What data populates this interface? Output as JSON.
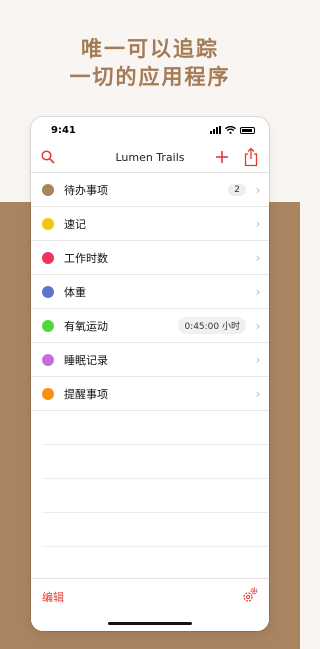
{
  "headline": {
    "line1": "唯一可以追踪",
    "line2": "一切的应用程序"
  },
  "status_bar": {
    "time": "9:41"
  },
  "nav": {
    "title": "Lumen Trails"
  },
  "items": [
    {
      "label": "待办事项",
      "color": "#a98461",
      "badge": "2"
    },
    {
      "label": "速记",
      "color": "#f2c70e"
    },
    {
      "label": "工作时数",
      "color": "#f0325f"
    },
    {
      "label": "体重",
      "color": "#5b78c8"
    },
    {
      "label": "有氧运动",
      "color": "#4ed93a",
      "value": "0:45:00 小时"
    },
    {
      "label": "睡眠记录",
      "color": "#c86ddc"
    },
    {
      "label": "提醒事项",
      "color": "#f7920e"
    }
  ],
  "toolbar": {
    "edit_label": "编辑"
  },
  "colors": {
    "accent": "#e53935",
    "brand": "#a98461",
    "headline": "#a57b55"
  }
}
